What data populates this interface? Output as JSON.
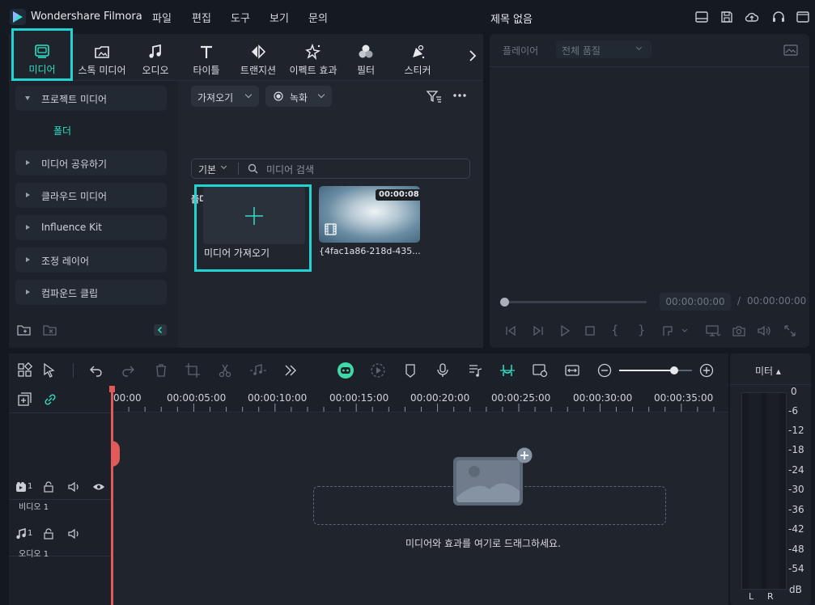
{
  "titlebar": {
    "app_title": "Wondershare Filmora",
    "menus": [
      "파일",
      "편집",
      "도구",
      "보기",
      "문의"
    ],
    "doc_title": "제목 없음",
    "icons": [
      "layout-icon",
      "save-icon",
      "cloud-upload-icon",
      "headset-icon",
      "account-icon"
    ]
  },
  "tabs": [
    {
      "label": "미디어",
      "icon": "media-icon",
      "active": true
    },
    {
      "label": "스톡 미디어",
      "icon": "stock-media-icon"
    },
    {
      "label": "오디오",
      "icon": "music-note-icon"
    },
    {
      "label": "타이틀",
      "icon": "title-t-icon"
    },
    {
      "label": "트랜지션",
      "icon": "transition-icon"
    },
    {
      "label": "이펙트 효과",
      "icon": "effects-icon"
    },
    {
      "label": "필터",
      "icon": "filter-icon"
    },
    {
      "label": "스티커",
      "icon": "sticker-icon"
    }
  ],
  "sidebar": {
    "items": [
      {
        "label": "프로젝트 미디어",
        "expanded": true
      },
      {
        "label": "미디어 공유하기"
      },
      {
        "label": "클라우드 미디어"
      },
      {
        "label": "Influence Kit"
      },
      {
        "label": "조정 레이어"
      },
      {
        "label": "컴파운드 클립"
      }
    ],
    "folder_label": "폴더"
  },
  "content": {
    "import_dropdown": "가져오기",
    "record_dropdown": "녹화",
    "sort_dropdown": "기본",
    "search_placeholder": "미디어 검색",
    "section_label": "폴더",
    "import_card_label": "미디어 가져오기",
    "video_clip": {
      "duration": "00:00:08",
      "name": "{4fac1a86-218d-435..."
    }
  },
  "player": {
    "label": "플레이어",
    "quality": "전체 품질",
    "current_time": "00:00:00:00",
    "separator": "/",
    "total_time": "00:00:00:00",
    "progress": 0
  },
  "timeline": {
    "ruler": [
      "00:00",
      "00:00:05:00",
      "00:00:10:00",
      "00:00:15:00",
      "00:00:20:00",
      "00:00:25:00",
      "00:00:30:00",
      "00:00:35:00"
    ],
    "video_track": {
      "number": "1",
      "label": "비디오 1"
    },
    "audio_track": {
      "number": "1",
      "label": "오디오 1"
    },
    "drop_hint": "미디어와 효과를 여기로 드래그하세요.",
    "zoom_level": 0.75
  },
  "meter": {
    "label": "미터 ▴",
    "scale": [
      "0",
      "-6",
      "-12",
      "-18",
      "-24",
      "-30",
      "-36",
      "-42",
      "-48",
      "-54",
      "dB"
    ],
    "channels": [
      "L",
      "R"
    ]
  },
  "colors": {
    "accent": "#2ee0c4",
    "highlight": "#22d3d3",
    "playhead": "#e05a5a"
  }
}
